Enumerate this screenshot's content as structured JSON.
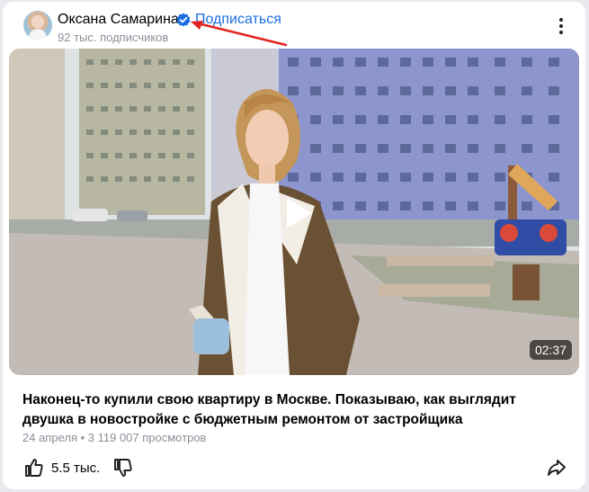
{
  "channel": {
    "name": "Оксана Самарина",
    "subscribe_label": "Подписаться",
    "subscribers": "92 тыс. подписчиков",
    "verified_icon": "verified-check-icon",
    "avatar": "avatar"
  },
  "video": {
    "duration": "02:37",
    "title": "Наконец-то купили свою квартиру в Москве. Показываю, как выглядит двушка в новостройке с бюджетным ремонтом от застройщика",
    "meta": "24 апреля • 3 119 007 просмотров",
    "play_icon": "play-icon"
  },
  "actions": {
    "likes": "5.5 тыс.",
    "like_icon": "thumbs-up-icon",
    "dislike_icon": "thumbs-down-icon",
    "share_icon": "share-arrow-icon",
    "more_icon": "more-vertical-icon"
  },
  "colors": {
    "accent": "#1a6fe5",
    "annotation_arrow": "#e5231f",
    "muted_text": "#8a8f99"
  }
}
